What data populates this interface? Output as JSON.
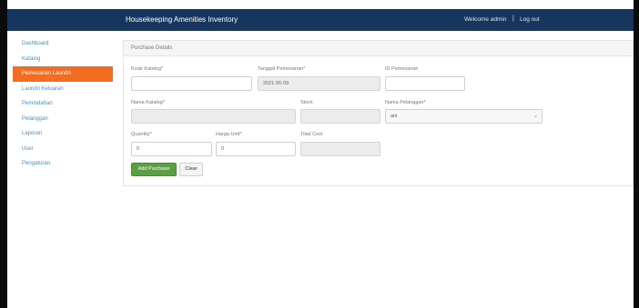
{
  "header": {
    "title": "Housekeeping Amenities Inventory",
    "welcome": "Welcome admin",
    "separator": "|",
    "logout": "Log out"
  },
  "sidebar": {
    "items": [
      {
        "label": "Dashboard"
      },
      {
        "label": "Katalog"
      },
      {
        "label": "Pemesanan Laundri",
        "active": true
      },
      {
        "label": "Laundri Keluaran"
      },
      {
        "label": "Pemindahan"
      },
      {
        "label": "Pelanggan"
      },
      {
        "label": "Laporan"
      },
      {
        "label": "User"
      },
      {
        "label": "Pengaturan"
      }
    ]
  },
  "panel": {
    "title": "Purchase Details"
  },
  "form": {
    "kode_katalog": {
      "label": "Kode Katalog*",
      "value": ""
    },
    "tanggal_pemesanan": {
      "label": "Tanggal Pemesanan*",
      "value": "2021-06-09"
    },
    "id_pemesanan": {
      "label": "ID Pemesanan",
      "value": ""
    },
    "nama_katalog": {
      "label": "Nama Katalog*",
      "value": ""
    },
    "stock": {
      "label": "Stock",
      "value": ""
    },
    "nama_pelanggan": {
      "label": "Nama Pelanggan*",
      "value": "ani"
    },
    "quantity": {
      "label": "Quantity*",
      "value": "0"
    },
    "harga_unit": {
      "label": "Harga Unit*",
      "value": "0"
    },
    "total_cost": {
      "label": "Total Cost",
      "value": ""
    }
  },
  "buttons": {
    "add": "Add Purchase",
    "clear": "Clear"
  },
  "colors": {
    "header_bg": "#17365f",
    "active_item": "#f26d21",
    "link": "#4a8fc7",
    "primary_button": "#5aa040"
  }
}
